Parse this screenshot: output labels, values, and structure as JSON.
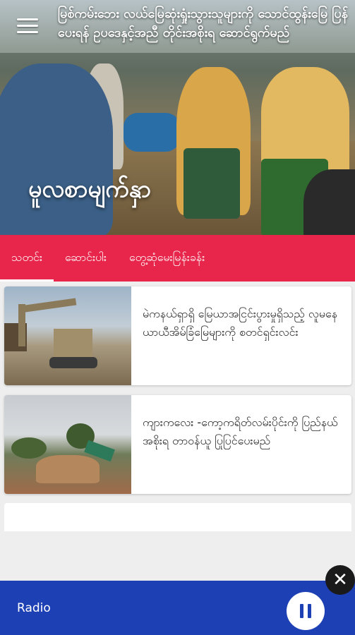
{
  "hero": {
    "headline": "မြစ်ကမ်းဘေး လယ်မြေဆုံးရှုံးသွားသူများကို သောင်ထွန်းမြေ ပြန်ပေးရန် ဥပဒေနှင့်အညီ တိုင်းအစိုးရ ဆောင်ရွက်မည်",
    "page_title": "မူလစာမျက်နှာ"
  },
  "tabs": [
    {
      "label": "သတင်း",
      "active": true
    },
    {
      "label": "ဆောင်းပါး",
      "active": false
    },
    {
      "label": "တွေ့ဆုံမေးမြန်းခန်း",
      "active": false
    }
  ],
  "articles": [
    {
      "headline": "မဲကနယ်ရှာရှိ မြေယာအငြင်းပွားမှုရှိသည့် လူမနေ ယာယီအိမ်ခြံမြေများကို စတင်ရှင်းလင်း"
    },
    {
      "headline": "ကျားကလေး -ကော့ကရိတ်လမ်းပိုင်းကို ပြည်နယ်အစိုးရ တာဝန်ယူ ပြုပြင်ပေးမည်"
    }
  ],
  "player": {
    "label": "Radio",
    "pause_icon": "pause-icon"
  },
  "icons": {
    "menu": "hamburger-menu-icon",
    "close": "close-icon"
  },
  "colors": {
    "tab_bar": "#e8254a",
    "player_bar": "#1d40b5"
  }
}
